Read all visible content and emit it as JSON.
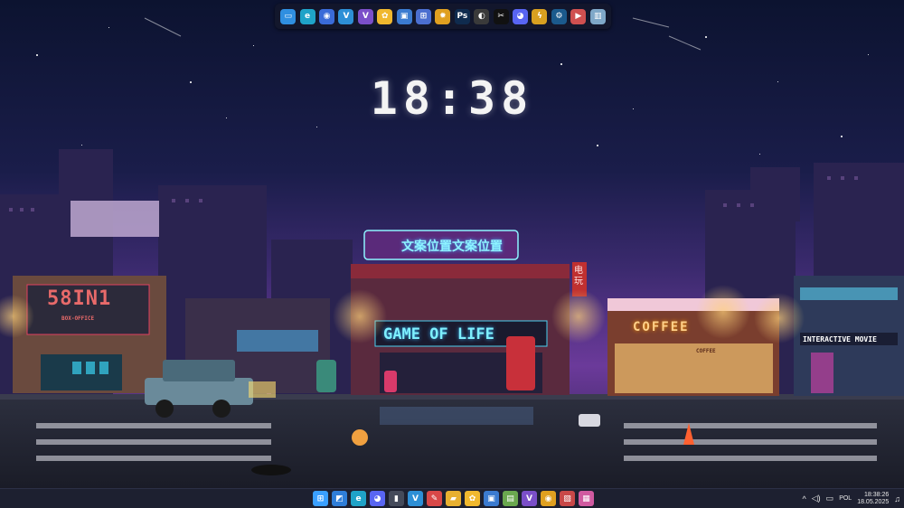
{
  "clock": {
    "time": "18:38"
  },
  "dock": {
    "icons": [
      {
        "name": "this-pc-icon",
        "glyph": "▭",
        "color": "#2f8fe0"
      },
      {
        "name": "edge-icon",
        "glyph": "e",
        "color": "#1fa3c8"
      },
      {
        "name": "browser-icon",
        "glyph": "◉",
        "color": "#3a6bd8"
      },
      {
        "name": "vscode-icon",
        "glyph": "V",
        "color": "#2d8fd6"
      },
      {
        "name": "visual-studio-icon",
        "glyph": "V",
        "color": "#7b4fc9"
      },
      {
        "name": "paw-icon",
        "glyph": "✿",
        "color": "#f0b82e"
      },
      {
        "name": "network-icon",
        "glyph": "▣",
        "color": "#3b7bd0"
      },
      {
        "name": "connections-icon",
        "glyph": "⊞",
        "color": "#4b6fd0"
      },
      {
        "name": "settings-gear-icon",
        "glyph": "✹",
        "color": "#e0a020"
      },
      {
        "name": "photoshop-icon",
        "glyph": "Ps",
        "color": "#0f2b4e"
      },
      {
        "name": "obs-icon",
        "glyph": "◐",
        "color": "#3a3a3a"
      },
      {
        "name": "capcut-icon",
        "glyph": "✂",
        "color": "#111111"
      },
      {
        "name": "discord-icon",
        "glyph": "◕",
        "color": "#5865f2"
      },
      {
        "name": "lightning-icon",
        "glyph": "ϟ",
        "color": "#d8a020"
      },
      {
        "name": "steam-icon",
        "glyph": "⚙",
        "color": "#1b5a8c"
      },
      {
        "name": "media-icon",
        "glyph": "▶",
        "color": "#d05050"
      },
      {
        "name": "recycle-bin-icon",
        "glyph": "▥",
        "color": "#7fa8c8"
      }
    ]
  },
  "scene": {
    "shop_left_big": "58IN1",
    "shop_left_small": "BOX-OFFICE",
    "neon_top": "文案位置文案位置",
    "game_sign": "GAME OF LIFE",
    "vertical_sign": "电玩",
    "coffee_sign": "COFFEE",
    "coffee_small": "COFFEE",
    "movie_sign": "INTERACTIVE MOVIE"
  },
  "taskbar": {
    "apps": [
      {
        "name": "start-button",
        "glyph": "⊞",
        "color": "#3aa0ff"
      },
      {
        "name": "widgets-icon",
        "glyph": "◩",
        "color": "#2f7ed8"
      },
      {
        "name": "edge-icon",
        "glyph": "e",
        "color": "#1fa3c8"
      },
      {
        "name": "discord-icon",
        "glyph": "◕",
        "color": "#5865f2"
      },
      {
        "name": "terminal-icon",
        "glyph": "▮",
        "color": "#444a5a"
      },
      {
        "name": "vscode-icon",
        "glyph": "V",
        "color": "#2d8fd6"
      },
      {
        "name": "paint-icon",
        "glyph": "✎",
        "color": "#d84848"
      },
      {
        "name": "folder-icon",
        "glyph": "▰",
        "color": "#e8b030"
      },
      {
        "name": "paw-icon",
        "glyph": "✿",
        "color": "#f0b82e"
      },
      {
        "name": "network-icon",
        "glyph": "▣",
        "color": "#3b7bd0"
      },
      {
        "name": "notepad-icon",
        "glyph": "▤",
        "color": "#6aa84f"
      },
      {
        "name": "visual-studio-icon",
        "glyph": "V",
        "color": "#7b4fc9"
      },
      {
        "name": "chrome-icon",
        "glyph": "◉",
        "color": "#e0a020"
      },
      {
        "name": "photos-icon",
        "glyph": "▧",
        "color": "#c84848"
      },
      {
        "name": "store-icon",
        "glyph": "▦",
        "color": "#d05aa0"
      }
    ],
    "language": "POL",
    "time": "18:38:26",
    "date": "18.05.2025"
  }
}
